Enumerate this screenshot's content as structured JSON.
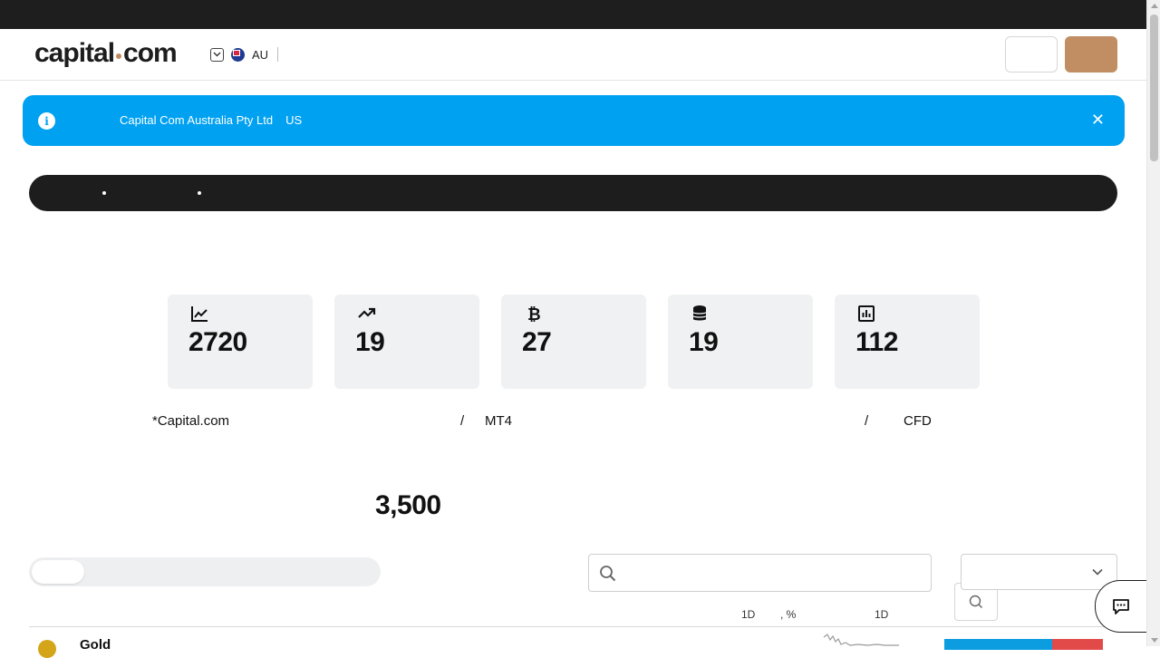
{
  "header": {
    "logo_left": "capital",
    "logo_right": "com",
    "region_code": "AU"
  },
  "banner": {
    "entity": "Capital Com Australia Pty Ltd",
    "country": "US",
    "close_glyph": "✕",
    "info_glyph": "i"
  },
  "stats": [
    {
      "icon": "line-chart-icon",
      "value": "2720"
    },
    {
      "icon": "trend-up-icon",
      "value": "19"
    },
    {
      "icon": "bitcoin-icon",
      "value": "27"
    },
    {
      "icon": "coins-stack-icon",
      "value": "19"
    },
    {
      "icon": "bar-chart-icon",
      "value": "112"
    }
  ],
  "fine_print": {
    "part1": "*Capital.com",
    "part2": "/",
    "part3": "MT4",
    "part4": "/",
    "part5": "CFD"
  },
  "markets_count": "3,500",
  "table": {
    "col_change": "1D",
    "col_change_pct": ", %",
    "col_chart": "1D",
    "rows": [
      {
        "name": "Gold"
      }
    ]
  },
  "colors": {
    "brand_accent": "#c08e62",
    "banner_bg": "#00a1f1",
    "buy": "#0b9de0",
    "sell": "#e24a49"
  }
}
